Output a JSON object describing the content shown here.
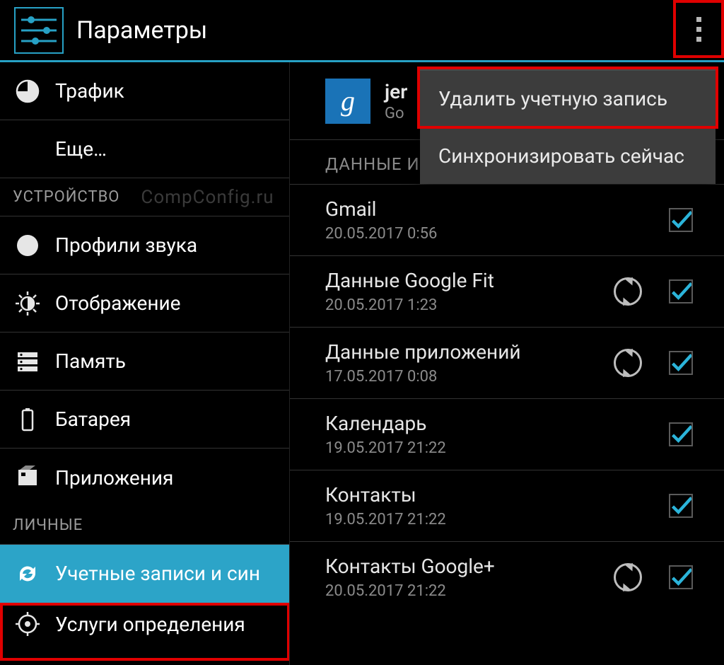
{
  "header": {
    "title": "Параметры"
  },
  "sidebar": {
    "items": [
      {
        "icon": "traffic-icon",
        "label": "Трафик"
      },
      {
        "icon": "",
        "label": "Еще…"
      }
    ],
    "section_device": "УСТРОЙСТВО",
    "watermark": "CompConfig.ru",
    "device_items": [
      {
        "icon": "segments-icon",
        "label": "Профили звука"
      },
      {
        "icon": "brightness-icon",
        "label": "Отображение"
      },
      {
        "icon": "storage-icon",
        "label": "Память"
      },
      {
        "icon": "battery-icon",
        "label": "Батарея"
      },
      {
        "icon": "apps-icon",
        "label": "Приложения"
      }
    ],
    "section_personal": "ЛИЧНЫЕ",
    "personal_items": [
      {
        "icon": "sync-icon",
        "label": "Учетные записи и син",
        "selected": true
      },
      {
        "icon": "location-icon",
        "label": "Услуги определения"
      }
    ]
  },
  "content": {
    "account": {
      "badge": "g",
      "name_partial": "jer",
      "sub_partial": "Go"
    },
    "section_label_partial": "ДАННЫЕ И",
    "sync_items": [
      {
        "title": "Gmail",
        "sub": "20.05.2017 0:56",
        "sync_icon": false,
        "checked": true
      },
      {
        "title": "Данные Google Fit",
        "sub": "20.05.2017 1:23",
        "sync_icon": true,
        "checked": true
      },
      {
        "title": "Данные приложений",
        "sub": "17.05.2017 0:08",
        "sync_icon": true,
        "checked": true
      },
      {
        "title": "Календарь",
        "sub": "19.05.2017 21:22",
        "sync_icon": false,
        "checked": true
      },
      {
        "title": "Контакты",
        "sub": "19.05.2017 21:22",
        "sync_icon": false,
        "checked": true
      },
      {
        "title": "Контакты Google+",
        "sub": "20.05.2017 21:22",
        "sync_icon": true,
        "checked": true
      }
    ]
  },
  "popup": {
    "items": [
      "Удалить учетную запись",
      "Синхронизировать сейчас"
    ]
  },
  "colors": {
    "accent": "#27a1c5",
    "highlight": "#e00000",
    "check": "#2bb4da"
  }
}
